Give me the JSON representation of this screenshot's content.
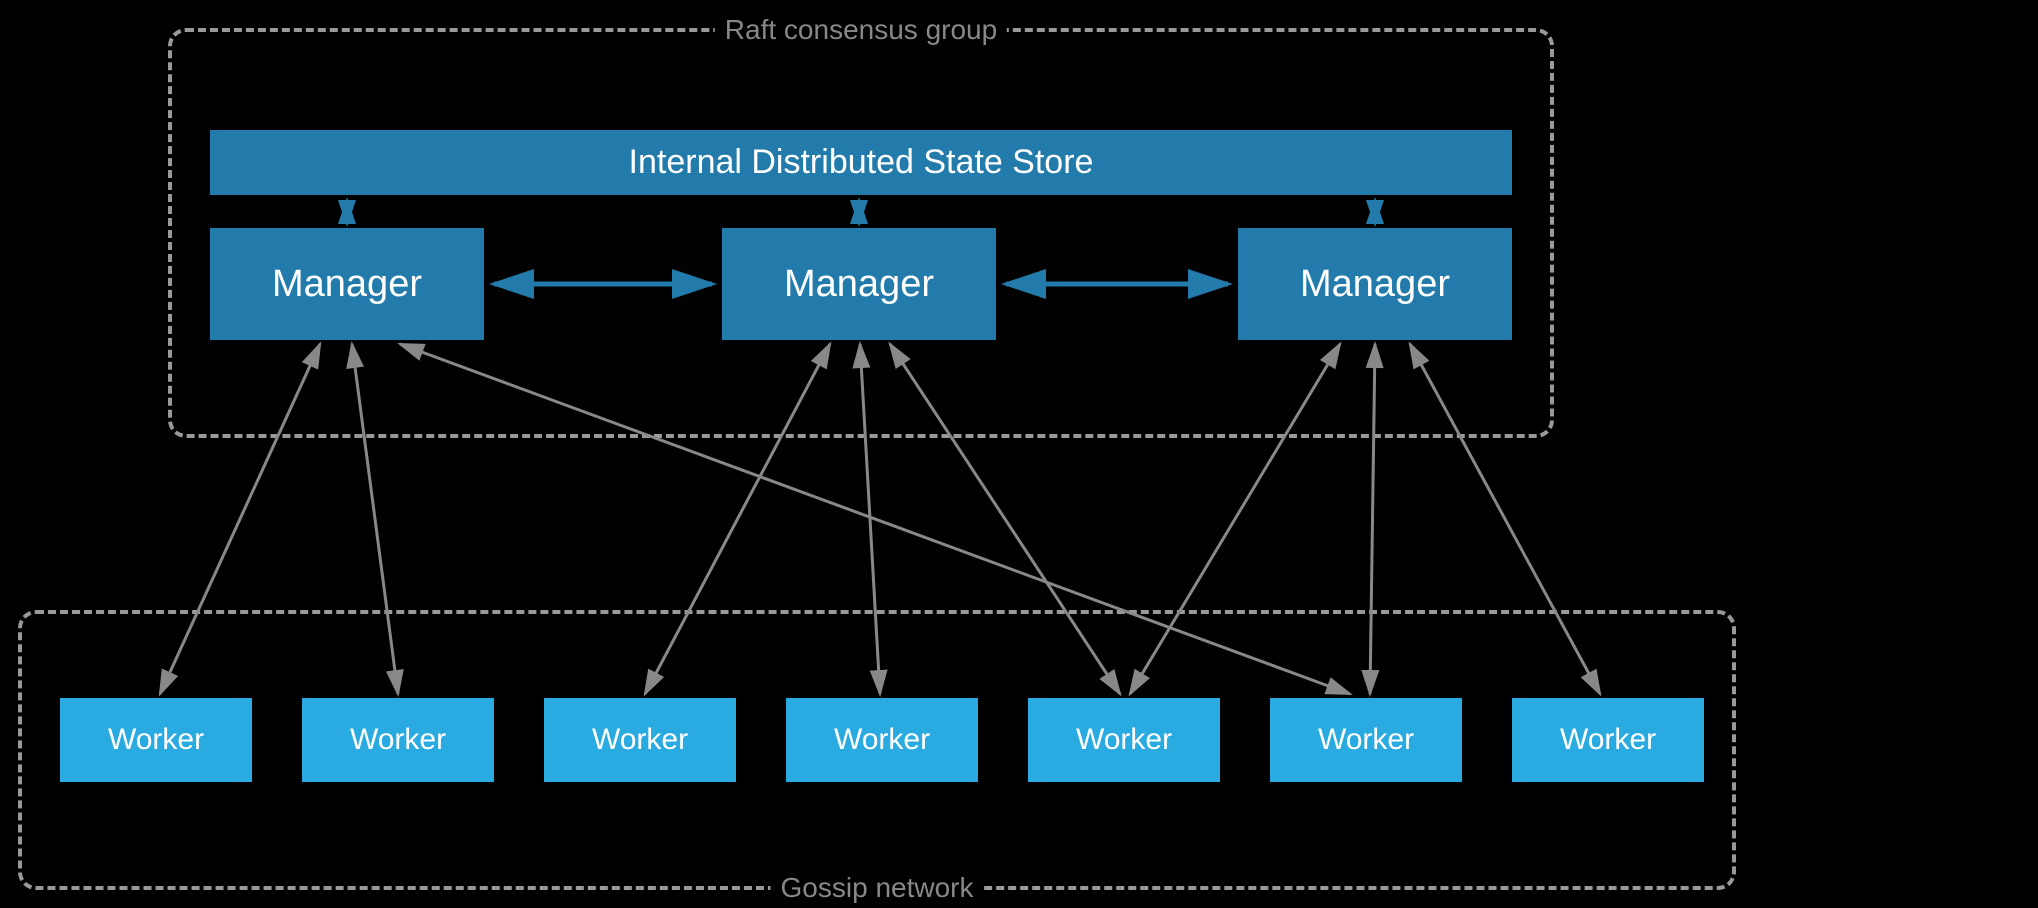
{
  "raft": {
    "label": "Raft consensus group"
  },
  "gossip": {
    "label": "Gossip network"
  },
  "state_store": {
    "label": "Internal Distributed State Store"
  },
  "managers": [
    {
      "label": "Manager"
    },
    {
      "label": "Manager"
    },
    {
      "label": "Manager"
    }
  ],
  "workers": [
    {
      "label": "Worker"
    },
    {
      "label": "Worker"
    },
    {
      "label": "Worker"
    },
    {
      "label": "Worker"
    },
    {
      "label": "Worker"
    },
    {
      "label": "Worker"
    },
    {
      "label": "Worker"
    }
  ],
  "connections": {
    "manager_to_workers": [
      {
        "manager": 0,
        "worker": 0
      },
      {
        "manager": 0,
        "worker": 1
      },
      {
        "manager": 1,
        "worker": 2
      },
      {
        "manager": 1,
        "worker": 3
      },
      {
        "manager": 1,
        "worker": 4
      },
      {
        "manager": 2,
        "worker": 4
      },
      {
        "manager": 2,
        "worker": 5
      },
      {
        "manager": 2,
        "worker": 6
      },
      {
        "manager": 0,
        "worker": 5
      }
    ],
    "manager_to_manager": [
      {
        "from": 0,
        "to": 1
      },
      {
        "from": 1,
        "to": 2
      }
    ],
    "manager_to_store": [
      0,
      1,
      2
    ]
  },
  "colors": {
    "dark_blue": "#227bab",
    "light_blue": "#29abe2",
    "gray": "#999",
    "arrow_gray": "#888"
  }
}
